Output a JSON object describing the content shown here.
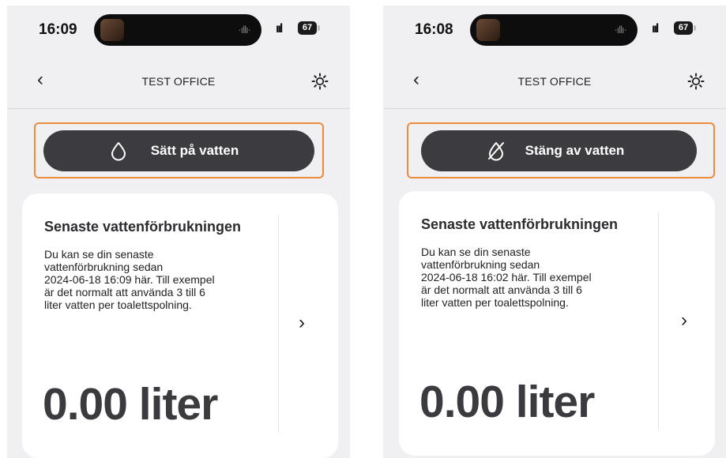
{
  "screens": [
    {
      "status": {
        "time": "16:09",
        "signal": "ııl",
        "battery": "67"
      },
      "nav": {
        "back": "‹",
        "title": "TEST OFFICE"
      },
      "water_button": {
        "label": "Sätt på vatten",
        "icon": "water-drop-icon"
      },
      "card": {
        "title": "Senaste vattenförbrukningen",
        "line1": "Du kan se din senaste",
        "line2": "vattenförbrukning sedan",
        "line3": "2024-06-18 16:09 här. Till exempel",
        "line4": "är det normalt att använda 3 till 6",
        "line5": "liter vatten per toalettspolning.",
        "value": "0.00 liter",
        "chevron": "›"
      }
    },
    {
      "status": {
        "time": "16:08",
        "signal": "ııl",
        "battery": "67"
      },
      "nav": {
        "back": "‹",
        "title": "TEST OFFICE"
      },
      "water_button": {
        "label": "Stäng av vatten",
        "icon": "water-drop-off-icon"
      },
      "card": {
        "title": "Senaste vattenförbrukningen",
        "line1": "Du kan se din senaste",
        "line2": "vattenförbrukning sedan",
        "line3": "2024-06-18 16:02 här. Till exempel",
        "line4": "är det normalt att använda 3 till 6",
        "line5": "liter vatten per toalettspolning.",
        "value": "0.00 liter",
        "chevron": "›"
      }
    }
  ],
  "colors": {
    "highlight": "#ec8b3a",
    "button": "#3b3b40",
    "background": "#f0f0f2",
    "card": "#ffffff"
  }
}
